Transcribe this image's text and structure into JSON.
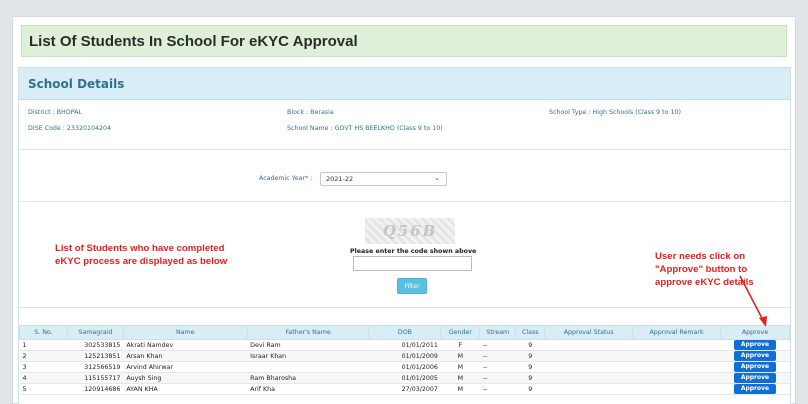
{
  "page_title": "List Of Students In School For eKYC Approval",
  "panel_title": "School Details",
  "school": {
    "district": "District : BHOPAL",
    "block": "Block : Berasia",
    "school_type": "School Type : High Schools (Class 9 to 10)",
    "dise_code": "DISE Code : 23320104204",
    "school_name": "School Name : GOVT HS BEELKHO (Class 9 to 10)"
  },
  "filter": {
    "academic_year_label": "Academic Year* :",
    "academic_year_value": "2021-22",
    "captcha_text": "Q56B",
    "captcha_label": "Please enter the code shown above",
    "captcha_input_value": "",
    "filter_button": "Filter"
  },
  "annotations": {
    "left": "List of Students who have completed eKYC process are displayed as below",
    "right": "User needs click on \"Approve\" button to approve eKYC details"
  },
  "table": {
    "headers": [
      "S. No.",
      "Samagraid",
      "Name",
      "Father's Name",
      "DOB",
      "Gender",
      "Stream",
      "Class",
      "Approval Status",
      "Approval Remark",
      "Approve"
    ],
    "rows": [
      {
        "sno": "1",
        "samagraid": "302533815",
        "name": "Akrati Namdev",
        "father": "Devi Ram",
        "dob": "01/01/2011",
        "gender": "F",
        "stream": "--",
        "class": "9",
        "status": "",
        "remark": "",
        "action": "Approve"
      },
      {
        "sno": "2",
        "samagraid": "125213851",
        "name": "Arsan Khan",
        "father": "Israar Khan",
        "dob": "01/01/2009",
        "gender": "M",
        "stream": "--",
        "class": "9",
        "status": "",
        "remark": "",
        "action": "Approve"
      },
      {
        "sno": "3",
        "samagraid": "312566519",
        "name": "Arvind Ahirwar",
        "father": "",
        "dob": "01/01/2006",
        "gender": "M",
        "stream": "--",
        "class": "9",
        "status": "",
        "remark": "",
        "action": "Approve"
      },
      {
        "sno": "4",
        "samagraid": "115155717",
        "name": "Auysh Sing",
        "father": "Ram Bharosha",
        "dob": "01/01/2005",
        "gender": "M",
        "stream": "--",
        "class": "9",
        "status": "",
        "remark": "",
        "action": "Approve"
      },
      {
        "sno": "5",
        "samagraid": "120914686",
        "name": "AYAN KHA",
        "father": "Arif Kha",
        "dob": "27/03/2007",
        "gender": "M",
        "stream": "--",
        "class": "9",
        "status": "",
        "remark": "",
        "action": "Approve"
      }
    ]
  },
  "colors": {
    "header_bg": "#dff0d8",
    "panel_heading_bg": "#d9edf7",
    "label_text": "#31708f",
    "annotation_red": "#e8201f",
    "approve_button": "#0f6fd6",
    "filter_button": "#5bc0de"
  }
}
